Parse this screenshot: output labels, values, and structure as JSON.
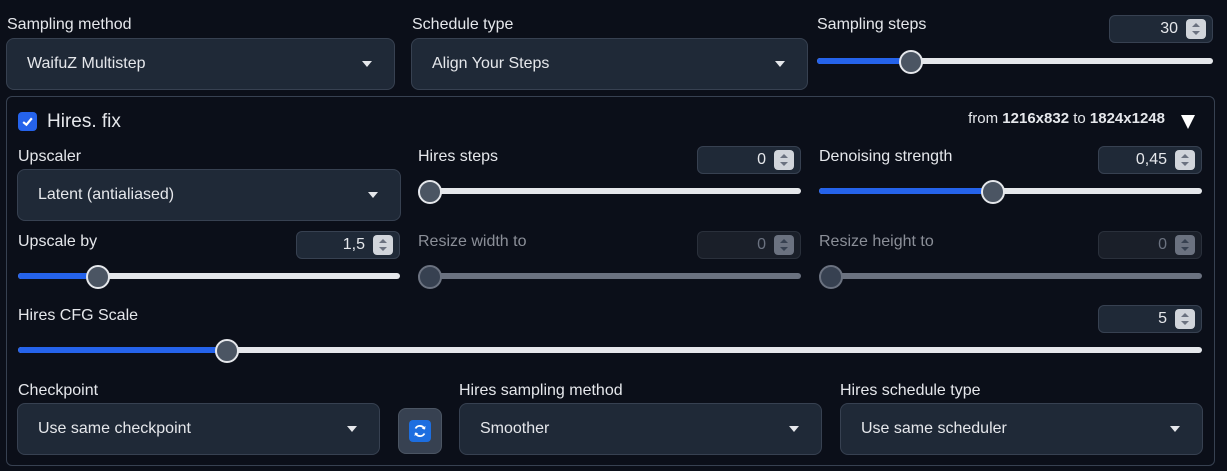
{
  "sampling": {
    "method_label": "Sampling method",
    "method_value": "WaifuZ Multistep",
    "schedule_label": "Schedule type",
    "schedule_value": "Align Your Steps",
    "steps_label": "Sampling steps",
    "steps_value": "30",
    "steps_fraction": 0.22
  },
  "hires": {
    "enabled": true,
    "label": "Hires. fix",
    "from_prefix": "from",
    "from_res": "1216x832",
    "to_prefix": "to",
    "to_res": "1824x1248",
    "upscaler_label": "Upscaler",
    "upscaler_value": "Latent (antialiased)",
    "steps_label": "Hires steps",
    "steps_value": "0",
    "steps_fraction": 0.0,
    "denoise_label": "Denoising strength",
    "denoise_value": "0,45",
    "denoise_fraction": 0.45,
    "upscale_label": "Upscale by",
    "upscale_value": "1,5",
    "upscale_fraction": 0.19,
    "resize_w_label": "Resize width to",
    "resize_w_value": "0",
    "resize_h_label": "Resize height to",
    "resize_h_value": "0",
    "cfg_label": "Hires CFG Scale",
    "cfg_value": "5",
    "cfg_fraction": 0.17,
    "checkpoint_label": "Checkpoint",
    "checkpoint_value": "Use same checkpoint",
    "sampler_label": "Hires sampling method",
    "sampler_value": "Smoother",
    "schedule_label": "Hires schedule type",
    "schedule_value": "Use same scheduler"
  },
  "colors": {
    "accent": "#2563eb",
    "background": "#0b0f19",
    "panel": "#1f2937"
  },
  "icons": {
    "caret": "chevron-down-icon",
    "refresh": "refresh-icon",
    "collapse": "triangle-down-icon",
    "check": "checkmark-icon"
  }
}
